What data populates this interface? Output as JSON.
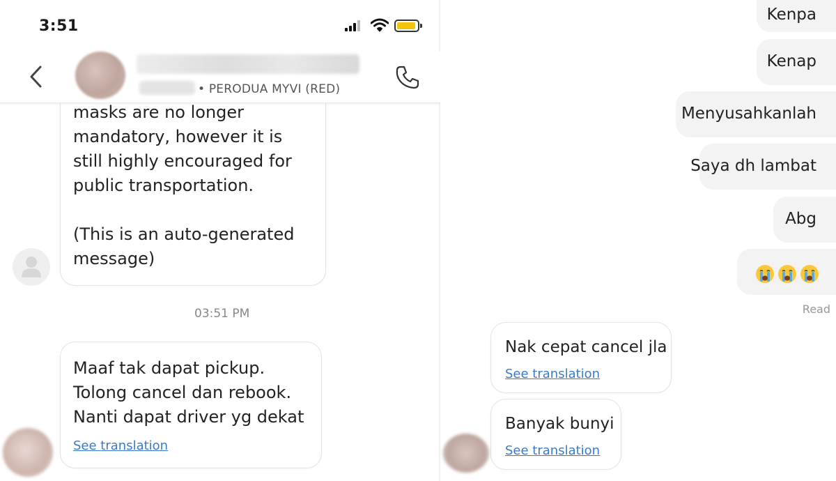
{
  "left": {
    "status_bar": {
      "time": "3:51",
      "battery_color": "#f2c40e"
    },
    "header": {
      "vehicle": "• PERODUA MYVI (RED)",
      "back_icon": "chevron-left-icon",
      "call_icon": "phone-icon"
    },
    "messages": [
      {
        "text": "masks are no longer\nmandatory, however it is\nstill highly encouraged for\npublic transportation.\n\n(This is an auto-generated\nmessage)"
      },
      {
        "text": "Maaf tak dapat pickup.\nTolong cancel dan rebook.\nNanti dapat driver yg dekat",
        "translate_label": "See translation"
      }
    ],
    "timestamp": "03:51 PM"
  },
  "right": {
    "sent": [
      {
        "text": "Kenpa"
      },
      {
        "text": "Kenap"
      },
      {
        "text": "Menyusahkanlah"
      },
      {
        "text": "Saya dh lambat"
      },
      {
        "text": "Abg"
      },
      {
        "text": "crying-emoji x3"
      }
    ],
    "read_label": "Read",
    "received": [
      {
        "text": "Nak cepat cancel jla",
        "translate_label": "See translation"
      },
      {
        "text": "Banyak bunyi",
        "translate_label": "See translation"
      }
    ]
  },
  "colors": {
    "link": "#3a7bc8",
    "sent_bubble": "#f3f3f3",
    "received_border": "#e3e3e3"
  }
}
